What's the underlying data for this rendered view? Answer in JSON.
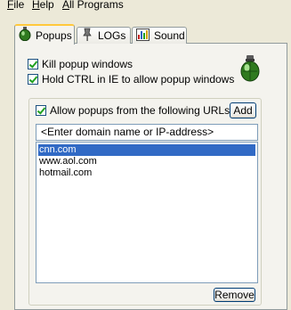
{
  "menu": [
    {
      "accel": "F",
      "rest": "ile"
    },
    {
      "accel": "H",
      "rest": "elp"
    },
    {
      "accel": "A",
      "rest": "ll Programs"
    }
  ],
  "tabs": [
    {
      "label": "Popups",
      "icon": "grenade-icon",
      "active": true
    },
    {
      "label": "LOGs",
      "icon": "pin-icon",
      "active": false
    },
    {
      "label": "Sound",
      "icon": "sound-icon",
      "active": false
    }
  ],
  "options": {
    "kill_popups": {
      "label": "Kill popup windows",
      "checked": true
    },
    "hold_ctrl": {
      "label": "Hold CTRL in IE to allow popup windows",
      "checked": true
    }
  },
  "allow_group": {
    "label": "Allow popups from the following URLs",
    "checked": true,
    "add_label": "Add",
    "input_placeholder": "<Enter domain name or IP-address>",
    "urls": [
      "cnn.com",
      "www.aol.com",
      "hotmail.com"
    ],
    "selected_url": "cnn.com",
    "remove_label": "Remove"
  },
  "colors": {
    "accent": "#316ac5",
    "tab_highlight": "#ffc83c",
    "grenade": "#2f7a1f"
  }
}
